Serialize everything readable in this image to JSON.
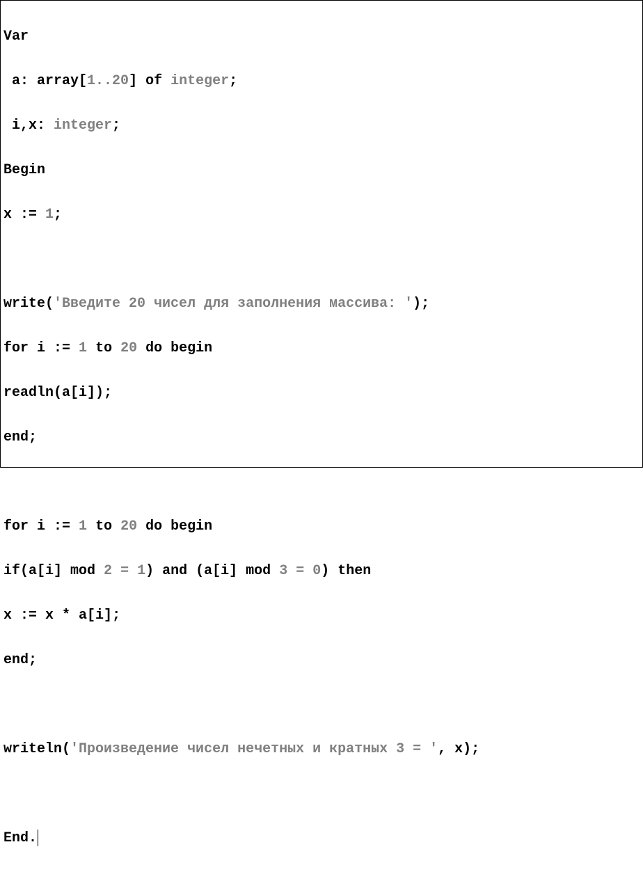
{
  "code": {
    "var_kw": "Var",
    "decl_a_prefix": " a: ",
    "array_kw": "array",
    "decl_a_bracket_open": "[",
    "decl_a_range": "1..20",
    "decl_a_bracket_close": "] ",
    "of_kw": "of",
    "space": " ",
    "integer_kw": "integer",
    "semicolon": ";",
    "decl_ix_prefix": " i,x: ",
    "begin_kw": "Begin",
    "assign_x_lhs": "x ",
    "assign_op": ":=",
    "assign_x_val": " 1",
    "write_fn": "write",
    "paren_open": "(",
    "paren_close": ")",
    "str_prompt": "'Введите 20 чисел для заполнения массива: '",
    "for_kw": "for",
    "for_var": " i ",
    "for_from": " 1 ",
    "to_kw": "to",
    "for_to": " 20 ",
    "do_kw": "do",
    "begin2_kw": "begin",
    "readln_fn": "readln",
    "readln_arg": "a[i]",
    "end_kw": "end",
    "if_kw": "if",
    "cond1_lhs": "a[i] ",
    "mod_kw": "mod",
    "cond1_rhs": " 2 = 1",
    "and_kw": "and",
    "cond2_lhs": "a[i] ",
    "cond2_rhs": " 3 = 0",
    "then_kw": "then",
    "assign2_lhs": "x ",
    "assign2_rhs": " x * a[i]",
    "writeln_fn": "writeln",
    "str_result": "'Произведение чисел нечетных и кратных 3 = '",
    "comma_x": ", x",
    "end_final": "End",
    "period": "."
  }
}
